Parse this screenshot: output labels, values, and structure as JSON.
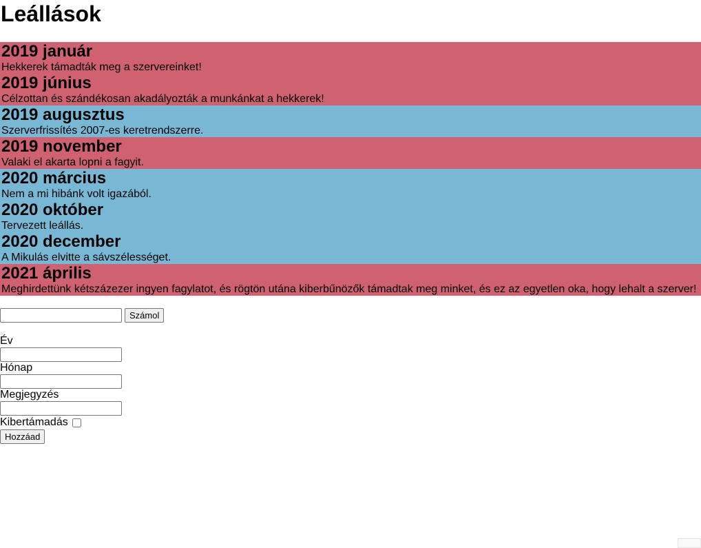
{
  "page": {
    "title": "Leállások"
  },
  "outages": [
    {
      "title": "2019 január",
      "description": "Hekkerek támadták meg a szervereinket!",
      "attack": true
    },
    {
      "title": "2019 június",
      "description": "Célzottan és szándékosan akadályozták a munkánkat a hekkerek!",
      "attack": true
    },
    {
      "title": "2019 augusztus",
      "description": "Szerverfrissítés 2007-es keretrendszerre.",
      "attack": false
    },
    {
      "title": "2019 november",
      "description": "Valaki el akarta lopni a fagyit.",
      "attack": true
    },
    {
      "title": "2020 március",
      "description": "Nem a mi hibánk volt igazából.",
      "attack": false
    },
    {
      "title": "2020 október",
      "description": "Tervezett leállás.",
      "attack": false
    },
    {
      "title": "2020 december",
      "description": "A Mikulás elvitte a sávszélességet.",
      "attack": false
    },
    {
      "title": "2021 április",
      "description": "Meghirdettünk kétszázezer ingyen fagylatot, és rögtön utána kiberbűnözők támadtak meg minket, és ez az egyetlen oka, hogy lehalt a szerver!",
      "attack": true
    }
  ],
  "colors": {
    "attack": "#cf6171",
    "normal": "#78b8d5"
  },
  "calc": {
    "input_value": "",
    "button_label": "Számol"
  },
  "form": {
    "year_label": "Év",
    "year_value": "",
    "month_label": "Hónap",
    "month_value": "",
    "note_label": "Megjegyzés",
    "note_value": "",
    "attack_label": "Kibertámadás",
    "attack_checked": false,
    "add_label": "Hozzáad"
  }
}
